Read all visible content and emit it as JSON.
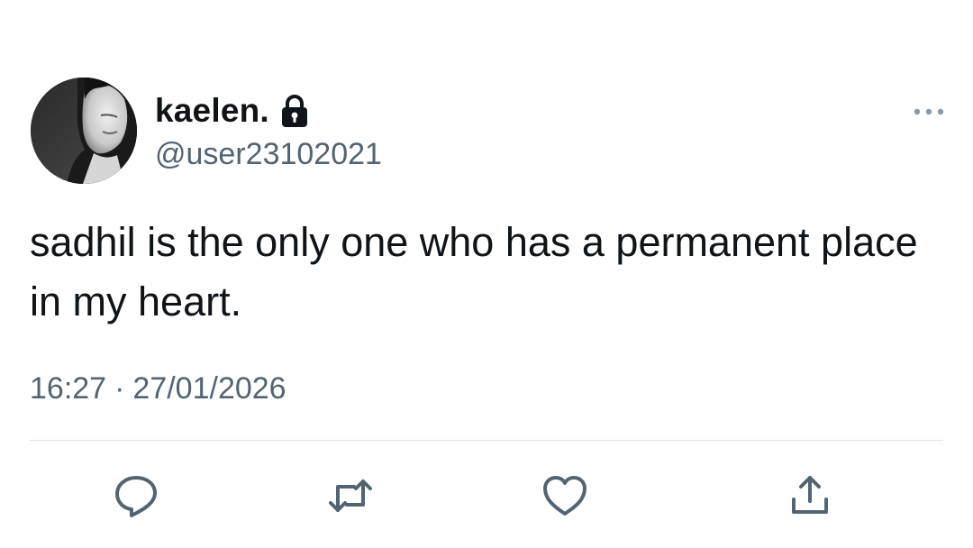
{
  "tweet": {
    "display_name": "kaelen.",
    "username": "@user23102021",
    "protected_icon": "lock-icon",
    "text": "sadhil is the only one who has a permanent place in my heart.",
    "time": "16:27",
    "separator": "·",
    "date": "27/01/2026"
  },
  "actions": {
    "reply_icon": "reply-icon",
    "retweet_icon": "retweet-icon",
    "like_icon": "heart-icon",
    "share_icon": "share-icon",
    "more_icon": "more-icon"
  },
  "colors": {
    "text_primary": "#0f1419",
    "text_secondary": "#536471",
    "icon": "#536471",
    "divider": "#dfe3e6"
  }
}
